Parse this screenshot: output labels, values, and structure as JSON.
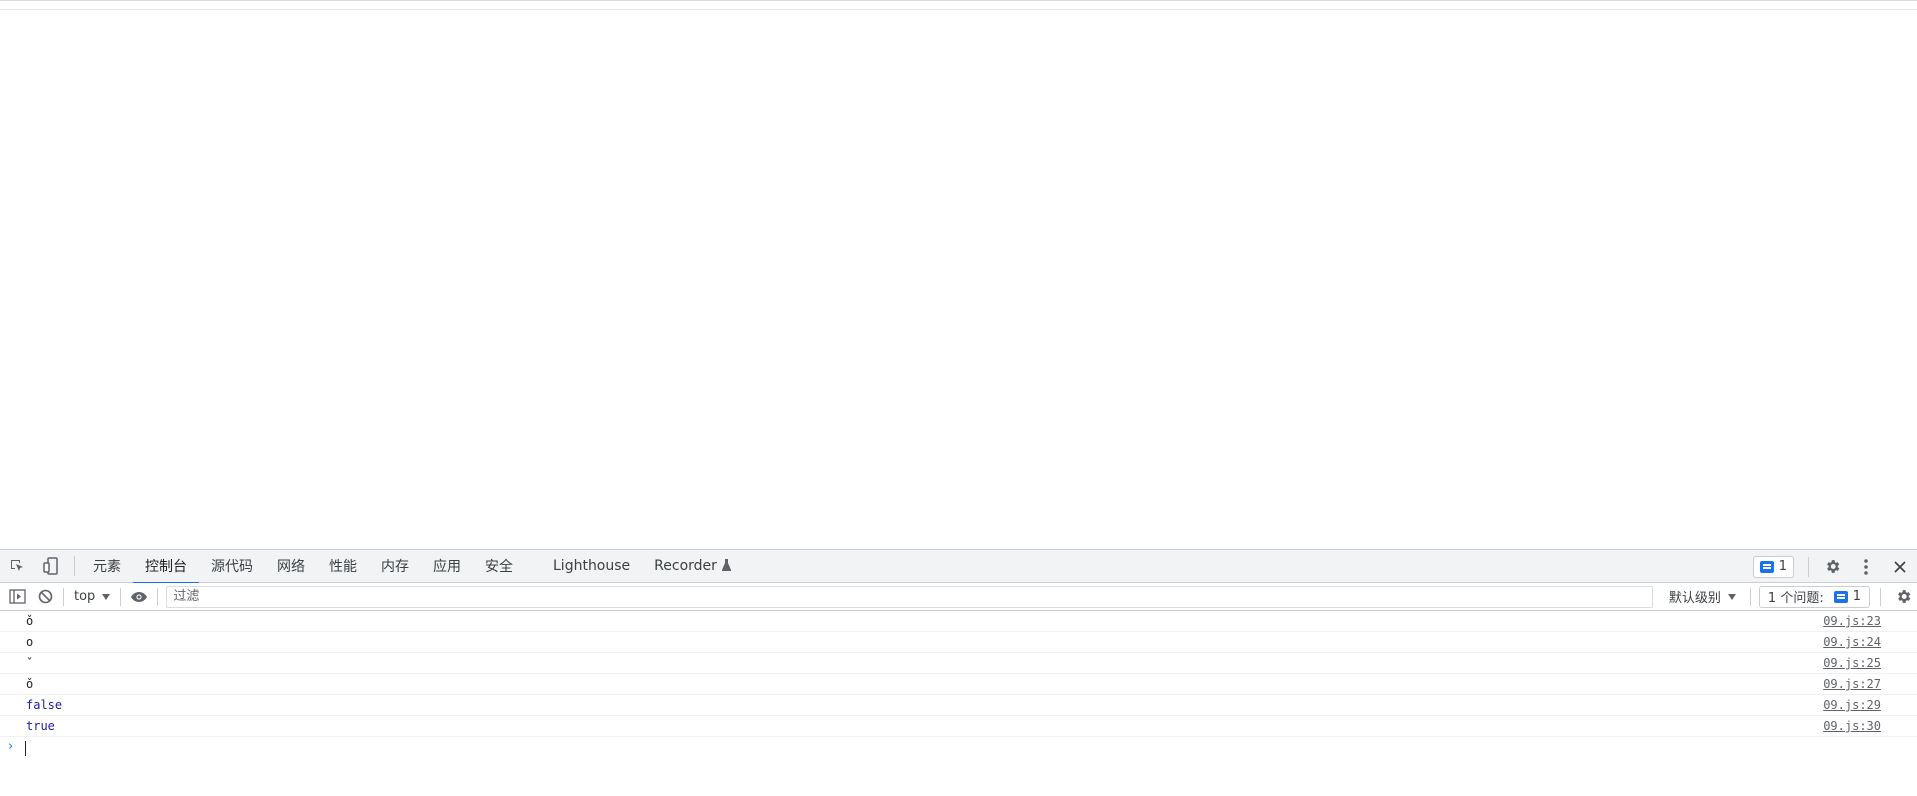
{
  "devtools": {
    "tabs": [
      {
        "label": "元素",
        "active": false
      },
      {
        "label": "控制台",
        "active": true
      },
      {
        "label": "源代码",
        "active": false
      },
      {
        "label": "网络",
        "active": false
      },
      {
        "label": "性能",
        "active": false
      },
      {
        "label": "内存",
        "active": false
      },
      {
        "label": "应用",
        "active": false
      },
      {
        "label": "安全",
        "active": false
      },
      {
        "label": "Lighthouse",
        "active": false
      },
      {
        "label": "Recorder",
        "active": false
      }
    ],
    "issues_badge_count": "1",
    "icons": {
      "inspect": "inspect-element-icon",
      "device": "device-toolbar-icon",
      "settings": "gear-icon",
      "more": "kebab-menu-icon",
      "close": "close-icon",
      "recorder": "flask-icon"
    }
  },
  "console_toolbar": {
    "context": "top",
    "filter_placeholder": "过滤",
    "level": "默认级别",
    "issues_label": "1 个问题:",
    "issues_count": "1"
  },
  "console": {
    "messages": [
      {
        "text": "ǒ",
        "type": "string",
        "source": "09.js:23"
      },
      {
        "text": "o",
        "type": "string",
        "source": "09.js:24"
      },
      {
        "text": "ˇ",
        "type": "string",
        "source": "09.js:25"
      },
      {
        "text": "ǒ",
        "type": "string",
        "source": "09.js:27"
      },
      {
        "text": "false",
        "type": "boolean",
        "source": "09.js:29"
      },
      {
        "text": "true",
        "type": "boolean",
        "source": "09.js:30"
      }
    ],
    "prompt_symbol": "›"
  },
  "colors": {
    "accent": "#1a73e8",
    "boolean": "#1a1aa6",
    "toolbar_bg": "#f1f3f4"
  }
}
